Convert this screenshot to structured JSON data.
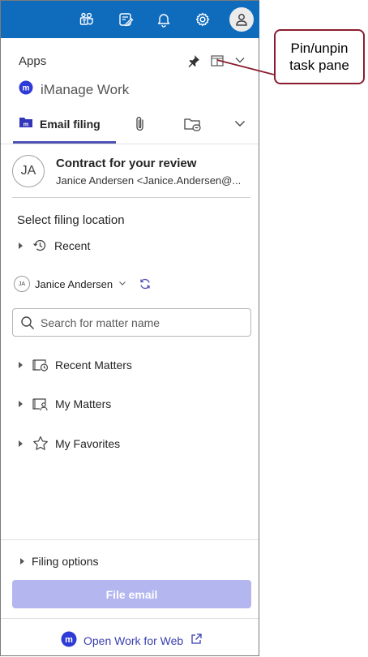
{
  "callout": {
    "text_line1": "Pin/unpin",
    "text_line2": "task pane"
  },
  "apps": {
    "label": "Apps"
  },
  "brand": {
    "name": "iManage Work"
  },
  "tabs": {
    "email_filing": "Email filing"
  },
  "email": {
    "avatar_initials": "JA",
    "subject": "Contract for your review",
    "from": "Janice Andersen <Janice.Andersen@..."
  },
  "filing": {
    "section_title": "Select filing location",
    "recent": "Recent",
    "user_initials": "JA",
    "user_name": "Janice Andersen",
    "search_placeholder": "Search for matter name",
    "recent_matters": "Recent Matters",
    "my_matters": "My Matters",
    "my_favorites": "My Favorites"
  },
  "footer": {
    "filing_options": "Filing options",
    "file_email": "File email",
    "open_web": "Open Work for Web"
  },
  "colors": {
    "topbar": "#0f6cbd",
    "accent": "#4f52b2",
    "file_button": "#b3b6ef",
    "callout_border": "#8b1d2e"
  }
}
